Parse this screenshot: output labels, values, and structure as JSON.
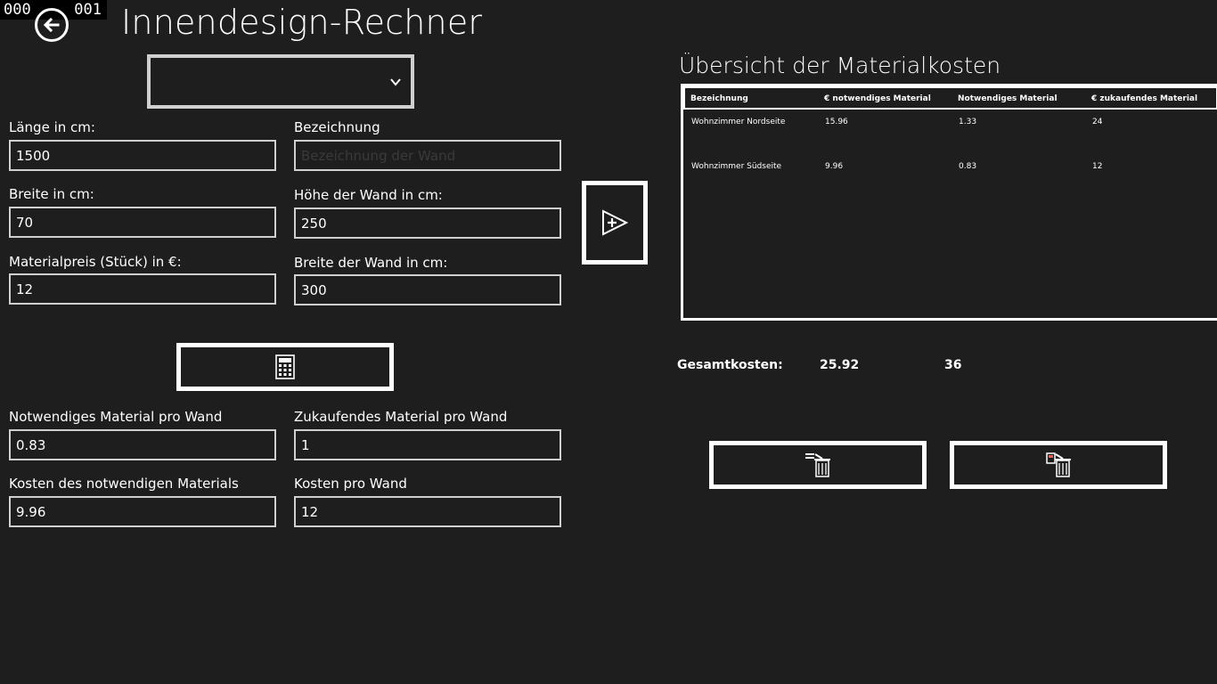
{
  "counter": {
    "left": "000",
    "right": "001"
  },
  "header": {
    "title": "Innendesign-Rechner"
  },
  "dropdown": {
    "selected": ""
  },
  "inputs": {
    "laenge": {
      "label": "Länge in cm:",
      "value": "1500"
    },
    "bezeichnung": {
      "label": "Bezeichnung",
      "value": "",
      "placeholder": "Bezeichnung der Wand"
    },
    "breite": {
      "label": "Breite in cm:",
      "value": "70"
    },
    "hoehe_wand": {
      "label": "Höhe der Wand in cm:",
      "value": "250"
    },
    "materialpreis": {
      "label": "Materialpreis (Stück) in €:",
      "value": "12"
    },
    "breite_wand": {
      "label": "Breite der Wand in cm:",
      "value": "300"
    }
  },
  "results": {
    "notwendiges": {
      "label": "Notwendiges Material pro Wand",
      "value": "0.83"
    },
    "zukaufendes": {
      "label": "Zukaufendes Material pro Wand",
      "value": "1"
    },
    "kosten_notwendig": {
      "label": "Kosten des notwendigen Materials",
      "value": "9.96"
    },
    "kosten_wand": {
      "label": "Kosten pro Wand",
      "value": "12"
    }
  },
  "buttons": {
    "calculate_icon": "calculator-icon",
    "add_icon": "add-to-list-icon",
    "delete_selected_icon": "delete-selected-icon",
    "delete_all_icon": "delete-all-icon"
  },
  "overview": {
    "title": "Übersicht der Materialkosten",
    "columns": [
      "Bezeichnung",
      "€ notwendiges Material",
      "Notwendiges Material",
      "€ zukaufendes Material"
    ],
    "rows": [
      [
        "Wohnzimmer Nordseite",
        "15.96",
        "1.33",
        "24"
      ],
      [
        "Wohnzimmer Südseite",
        "9.96",
        "0.83",
        "12"
      ]
    ]
  },
  "totals": {
    "label": "Gesamtkosten:",
    "notwendig": "25.92",
    "zukaufend": "36"
  },
  "colors": {
    "background": "#1e1e1e",
    "foreground": "#ffffff",
    "border": "#cfcfcf"
  }
}
